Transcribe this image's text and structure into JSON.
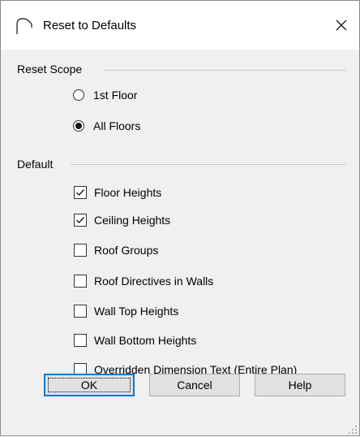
{
  "window": {
    "title": "Reset to Defaults",
    "icon": "arch-icon",
    "close_glyph": "✕"
  },
  "reset_scope": {
    "label": "Reset Scope",
    "options": [
      {
        "label": "1st Floor",
        "selected": false
      },
      {
        "label": "All Floors",
        "selected": true
      }
    ]
  },
  "default": {
    "label": "Default",
    "items": [
      {
        "label": "Floor Heights",
        "checked": true
      },
      {
        "label": "Ceiling Heights",
        "checked": true
      },
      {
        "label": "Roof Groups",
        "checked": false
      },
      {
        "label": "Roof Directives in Walls",
        "checked": false
      },
      {
        "label": "Wall Top Heights",
        "checked": false
      },
      {
        "label": "Wall Bottom Heights",
        "checked": false
      },
      {
        "label": "Overridden Dimension Text (Entire Plan)",
        "checked": false
      }
    ]
  },
  "buttons": {
    "ok": "OK",
    "cancel": "Cancel",
    "help": "Help"
  },
  "colors": {
    "dialog_bg": "#f0f0f0",
    "titlebar_bg": "#ffffff",
    "default_button_border": "#0078d7",
    "button_bg": "#e1e1e1"
  }
}
